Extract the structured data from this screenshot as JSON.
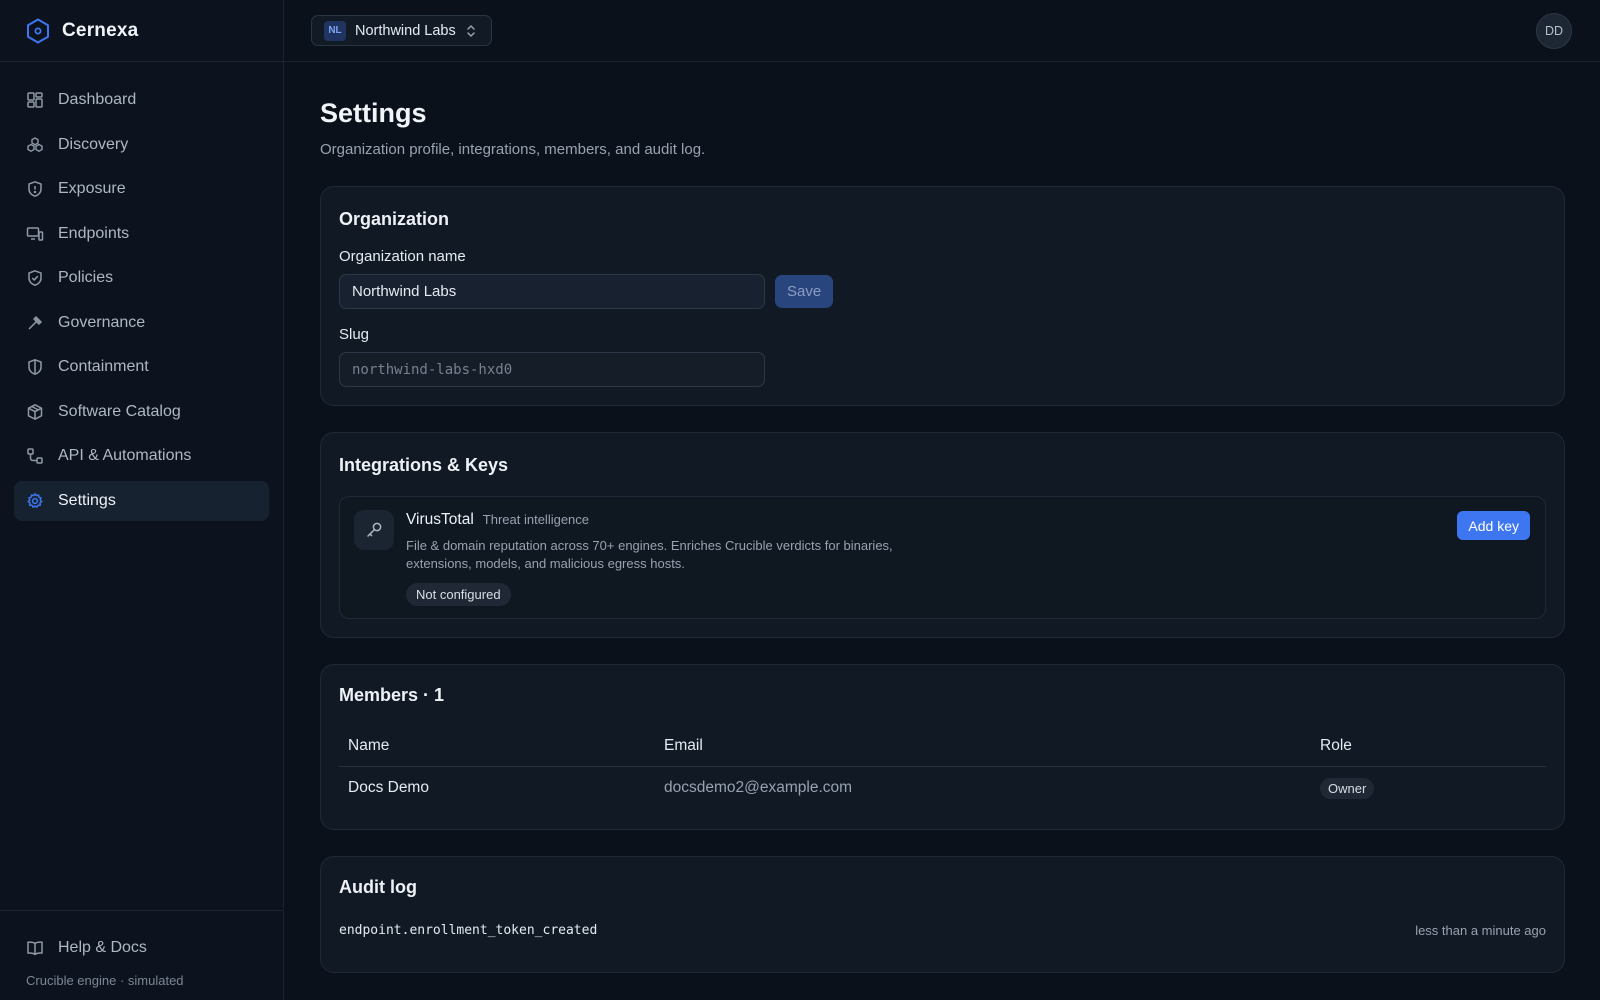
{
  "brand": {
    "name": "Cernexa"
  },
  "sidebar": {
    "items": [
      {
        "label": "Dashboard",
        "icon": "grid-icon"
      },
      {
        "label": "Discovery",
        "icon": "cubes-icon"
      },
      {
        "label": "Exposure",
        "icon": "shield-alert-icon"
      },
      {
        "label": "Endpoints",
        "icon": "monitor-icon"
      },
      {
        "label": "Policies",
        "icon": "shield-check-icon"
      },
      {
        "label": "Governance",
        "icon": "gavel-icon"
      },
      {
        "label": "Containment",
        "icon": "shield-half-icon"
      },
      {
        "label": "Software Catalog",
        "icon": "package-icon"
      },
      {
        "label": "API & Automations",
        "icon": "workflow-icon"
      },
      {
        "label": "Settings",
        "icon": "gear-icon",
        "active": true
      }
    ],
    "help_label": "Help & Docs",
    "engine_note": "Crucible engine · simulated"
  },
  "topbar": {
    "org_initials": "NL",
    "org_name": "Northwind Labs",
    "avatar_initials": "DD"
  },
  "page": {
    "title": "Settings",
    "subtitle": "Organization profile, integrations, members, and audit log."
  },
  "organization": {
    "title": "Organization",
    "name_label": "Organization name",
    "name_value": "Northwind Labs",
    "save_label": "Save",
    "slug_label": "Slug",
    "slug_value": "northwind-labs-hxd0"
  },
  "integrations": {
    "title": "Integrations & Keys",
    "items": [
      {
        "name": "VirusTotal",
        "category": "Threat intelligence",
        "description": "File & domain reputation across 70+ engines. Enriches Crucible verdicts for binaries, extensions, models, and malicious egress hosts.",
        "status": "Not configured",
        "action_label": "Add key"
      }
    ]
  },
  "members": {
    "title": "Members · 1",
    "columns": [
      "Name",
      "Email",
      "Role"
    ],
    "rows": [
      {
        "name": "Docs Demo",
        "email": "docsdemo2@example.com",
        "role": "Owner"
      }
    ]
  },
  "audit": {
    "title": "Audit log",
    "entries": [
      {
        "event": "endpoint.enrollment_token_created",
        "time": "less than a minute ago"
      }
    ]
  },
  "colors": {
    "accent": "#3d76f0",
    "background": "#0b111b",
    "card": "#111924"
  }
}
